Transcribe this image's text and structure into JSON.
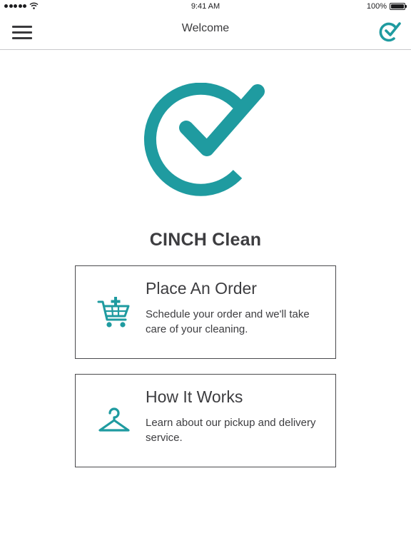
{
  "status_bar": {
    "time": "9:41 AM",
    "battery": "100%"
  },
  "nav": {
    "title": "Welcome",
    "menu_icon": "hamburger-icon",
    "right_icon": "check-circle-icon"
  },
  "brand": {
    "title": "CINCH Clean",
    "logo_icon": "cinch-check-logo"
  },
  "accent_color": "#1f9ba0",
  "cards": [
    {
      "title": "Place An Order",
      "description": "Schedule your order and we'll take care of your cleaning.",
      "icon": "cart-add-icon"
    },
    {
      "title": "How It Works",
      "description": "Learn about our pickup and delivery service.",
      "icon": "hanger-icon"
    }
  ]
}
